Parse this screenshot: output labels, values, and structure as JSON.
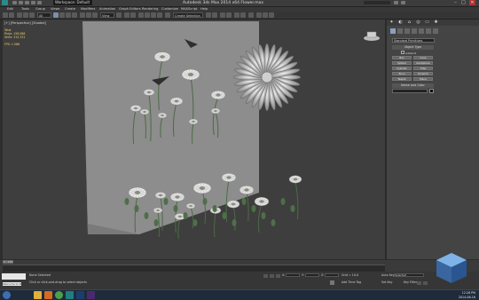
{
  "app": {
    "title": "Autodesk 3ds Max  2014 x64     Flower.max",
    "workspace": "Workspace: Default",
    "window_controls": [
      "–",
      "□",
      "✕"
    ]
  },
  "menu": [
    "Edit",
    "Tools",
    "Group",
    "Views",
    "Create",
    "Modifiers",
    "Animation",
    "Graph Editors",
    "Rendering",
    "Customize",
    "MAXScript",
    "Help"
  ],
  "toolbar": {
    "selection_filter": "All",
    "view_dropdown": "View",
    "named_selection": "Create Selection Se"
  },
  "viewport": {
    "label": "[+] [Perspective] [Shaded]",
    "stats": {
      "title": "Total",
      "polys_label": "Polys:",
      "polys_value": "158,988",
      "verts_label": "Verts:",
      "verts_value": "315,331",
      "fps_label": "FPS:",
      "fps_value": "1.588"
    }
  },
  "command_panel": {
    "category": "Standard Primitives",
    "rollout_object_type": "Object Type",
    "autogrid": "AutoGrid",
    "buttons": [
      "Box",
      "Cone",
      "Sphere",
      "GeoSphere",
      "Cylinder",
      "Tube",
      "Torus",
      "Pyramid",
      "Teapot",
      "Plane"
    ],
    "rollout_name_color": "Name and Color"
  },
  "timeline": {
    "slider": "0 / 100",
    "ticks": [
      "0",
      "5",
      "10",
      "15",
      "20",
      "25",
      "30",
      "35",
      "40",
      "45",
      "50",
      "55",
      "60",
      "65",
      "70",
      "75",
      "80",
      "85",
      "90",
      "95",
      "100"
    ]
  },
  "status": {
    "selection": "None Selected",
    "prompt": "Click or click-and-drag to select objects",
    "welcome": "Welcome to M",
    "x_label": "X:",
    "y_label": "Y:",
    "z_label": "Z:",
    "grid": "Grid = 10.0",
    "add_time_tag": "Add Time Tag",
    "auto_key": "Auto Key",
    "set_key": "Set Key",
    "selected": "Selected",
    "key_filters": "Key Filters..."
  },
  "taskbar": {
    "time": "12:28 PM",
    "date": "2014-06-16"
  }
}
